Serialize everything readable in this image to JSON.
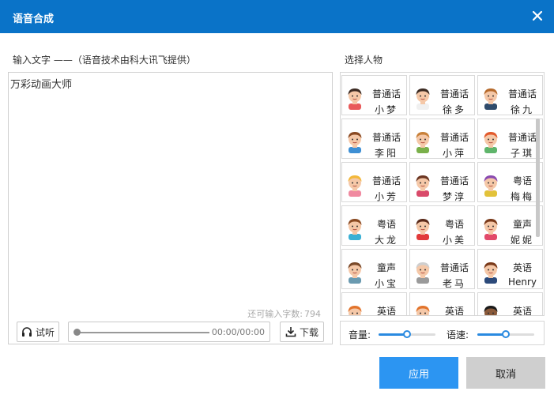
{
  "dialog": {
    "title": "语音合成"
  },
  "input": {
    "label": "输入文字 ——（语音技术由科大讯飞提供）",
    "text": "万彩动画大师",
    "remain_label": "还可输入字数:",
    "remain_count": "794"
  },
  "player": {
    "listen_label": "试听",
    "time": "00:00/00:00",
    "progress": 0,
    "download_label": "下载"
  },
  "characters": {
    "label": "选择人物",
    "items": [
      {
        "type": "普通话",
        "name": "小梦",
        "avatar": "girl-dark-hair",
        "hair": "#3b2a22",
        "shirt": "#e95a5a",
        "skin": "#f5c8a8"
      },
      {
        "type": "普通话",
        "name": "徐多",
        "avatar": "man-mustache",
        "hair": "#3b2a22",
        "shirt": "#f0f0f0",
        "skin": "#f5c8a8"
      },
      {
        "type": "普通话",
        "name": "徐九",
        "avatar": "boy-brown-hair",
        "hair": "#b66a2c",
        "shirt": "#2f4b6b",
        "skin": "#f5c8a8"
      },
      {
        "type": "普通话",
        "name": "李阳",
        "avatar": "boy-glasses",
        "hair": "#8a4a22",
        "shirt": "#3e8fd4",
        "skin": "#f5c8a8"
      },
      {
        "type": "普通话",
        "name": "小萍",
        "avatar": "girl-glasses",
        "hair": "#c8813a",
        "shirt": "#7ab04a",
        "skin": "#f5c8a8"
      },
      {
        "type": "普通话",
        "name": "子琪",
        "avatar": "girl-red-hair",
        "hair": "#e25a2c",
        "shirt": "#5fb56b",
        "skin": "#f5c8a8"
      },
      {
        "type": "普通话",
        "name": "小芳",
        "avatar": "girl-blonde",
        "hair": "#f3b83a",
        "shirt": "#f08aa0",
        "skin": "#f5c8a8"
      },
      {
        "type": "普通话",
        "name": "梦淳",
        "avatar": "woman-brown-hair",
        "hair": "#6b3522",
        "shirt": "#d94a6a",
        "skin": "#f5c8a8"
      },
      {
        "type": "粤语",
        "name": "梅梅",
        "avatar": "woman-purple-hair",
        "hair": "#8a4ab0",
        "shirt": "#e2c23a",
        "skin": "#f5c8a8"
      },
      {
        "type": "粤语",
        "name": "大龙",
        "avatar": "boy-blue",
        "hair": "#8a4a22",
        "shirt": "#3ab0d4",
        "skin": "#f5c8a8"
      },
      {
        "type": "粤语",
        "name": "小美",
        "avatar": "girl-bun",
        "hair": "#5a2a1a",
        "shirt": "#e23a3a",
        "skin": "#f5c8a8"
      },
      {
        "type": "童声",
        "name": "妮妮",
        "avatar": "girl-pigtails",
        "hair": "#7a3a1a",
        "shirt": "#e24a6a",
        "skin": "#f5c8a8"
      },
      {
        "type": "童声",
        "name": "小宝",
        "avatar": "boy-brown-shirt",
        "hair": "#7a4a2a",
        "shirt": "#6a9ab0",
        "skin": "#f5c8a8"
      },
      {
        "type": "普通话",
        "name": "老马",
        "avatar": "old-man-gray",
        "hair": "#cfcfcf",
        "shirt": "#9a9a9a",
        "skin": "#f5c8a8"
      },
      {
        "type": "英语",
        "name": "Henry",
        "avatar": "man-beard",
        "hair": "#7a3a1a",
        "shirt": "#2c4a7a",
        "skin": "#f5c8a8"
      },
      {
        "type": "英语",
        "name": "",
        "avatar": "girl-orange-hair",
        "hair": "#e2742c",
        "shirt": "#e2742c",
        "skin": "#f5c8a8"
      },
      {
        "type": "英语",
        "name": "",
        "avatar": "girl-orange-hair-2",
        "hair": "#e2742c",
        "shirt": "#e2742c",
        "skin": "#f5c8a8"
      },
      {
        "type": "英语",
        "name": "",
        "avatar": "man-dark-skin",
        "hair": "#1a1a1a",
        "shirt": "#3a3a3a",
        "skin": "#8a5a3a"
      }
    ]
  },
  "controls": {
    "volume_label": "音量:",
    "volume_level": 0.5,
    "speed_label": "语速:",
    "speed_level": 0.5,
    "accent": "#2a8ae0"
  },
  "buttons": {
    "apply": "应用",
    "cancel": "取消"
  }
}
